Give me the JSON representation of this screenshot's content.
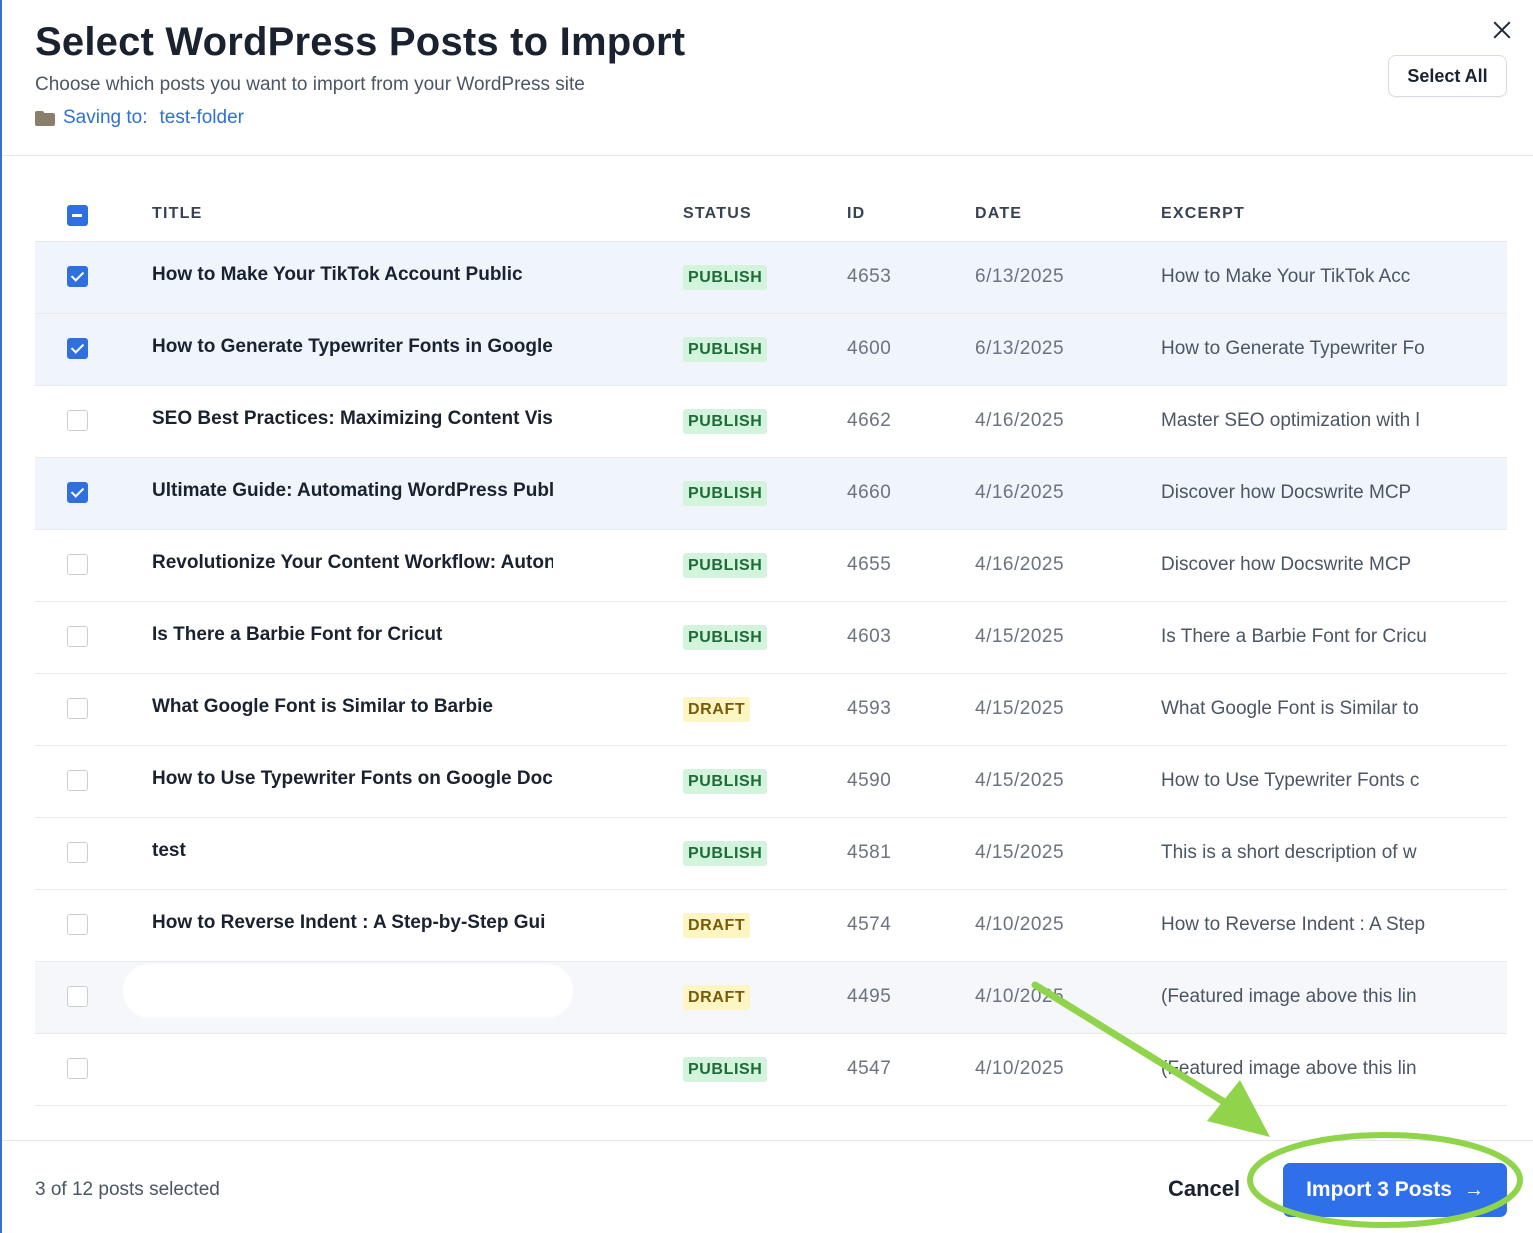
{
  "header": {
    "title": "Select WordPress Posts to Import",
    "subtitle": "Choose which posts you want to import from your WordPress site",
    "saving_label": "Saving to:",
    "folder": "test-folder",
    "select_all_label": "Select All",
    "close_icon": "close-icon"
  },
  "table": {
    "columns": {
      "title": "TITLE",
      "status": "STATUS",
      "id": "ID",
      "date": "DATE",
      "excerpt": "EXCERPT"
    },
    "rows": [
      {
        "selected": true,
        "title": "How to Make Your TikTok Account Public",
        "status": "PUBLISH",
        "id": "4653",
        "date": "6/13/2025",
        "excerpt": "How to Make Your TikTok Acc"
      },
      {
        "selected": true,
        "title": "How to Generate Typewriter Fonts in Google",
        "status": "PUBLISH",
        "id": "4600",
        "date": "6/13/2025",
        "excerpt": "How to Generate Typewriter Fo"
      },
      {
        "selected": false,
        "title": "SEO Best Practices: Maximizing Content Visi",
        "status": "PUBLISH",
        "id": "4662",
        "date": "4/16/2025",
        "excerpt": "Master SEO optimization with l"
      },
      {
        "selected": true,
        "title": "Ultimate Guide: Automating WordPress Publi",
        "status": "PUBLISH",
        "id": "4660",
        "date": "4/16/2025",
        "excerpt": "Discover how Docswrite MCP"
      },
      {
        "selected": false,
        "title": "Revolutionize Your Content Workflow: Auton",
        "status": "PUBLISH",
        "id": "4655",
        "date": "4/16/2025",
        "excerpt": "Discover how Docswrite MCP"
      },
      {
        "selected": false,
        "title": "Is There a Barbie Font for Cricut",
        "status": "PUBLISH",
        "id": "4603",
        "date": "4/15/2025",
        "excerpt": "Is There a Barbie Font for Cricu"
      },
      {
        "selected": false,
        "title": "What Google Font is Similar to Barbie",
        "status": "DRAFT",
        "id": "4593",
        "date": "4/15/2025",
        "excerpt": "What Google Font is Similar to"
      },
      {
        "selected": false,
        "title": "How to Use Typewriter Fonts on Google Doc",
        "status": "PUBLISH",
        "id": "4590",
        "date": "4/15/2025",
        "excerpt": "How to Use Typewriter Fonts c"
      },
      {
        "selected": false,
        "title": "test",
        "status": "PUBLISH",
        "id": "4581",
        "date": "4/15/2025",
        "excerpt": "This is a short description of w"
      },
      {
        "selected": false,
        "title": "How to Reverse Indent : A Step-by-Step Gui",
        "status": "DRAFT",
        "id": "4574",
        "date": "4/10/2025",
        "excerpt": "How to Reverse Indent : A Step"
      },
      {
        "selected": false,
        "title": "",
        "status": "DRAFT",
        "id": "4495",
        "date": "4/10/2025",
        "excerpt": "(Featured image above this lin"
      },
      {
        "selected": false,
        "title": "",
        "status": "PUBLISH",
        "id": "4547",
        "date": "4/10/2025",
        "excerpt": "(Featured image above this lin"
      }
    ]
  },
  "footer": {
    "selection_count": "3 of 12 posts selected",
    "cancel_label": "Cancel",
    "import_label": "Import 3 Posts",
    "import_icon": "arrow-right-icon"
  },
  "colors": {
    "primary": "#2f6fe9",
    "publish_bg": "#d3f3dc",
    "draft_bg": "#fdf5c2",
    "annotation": "#8fd44a"
  }
}
